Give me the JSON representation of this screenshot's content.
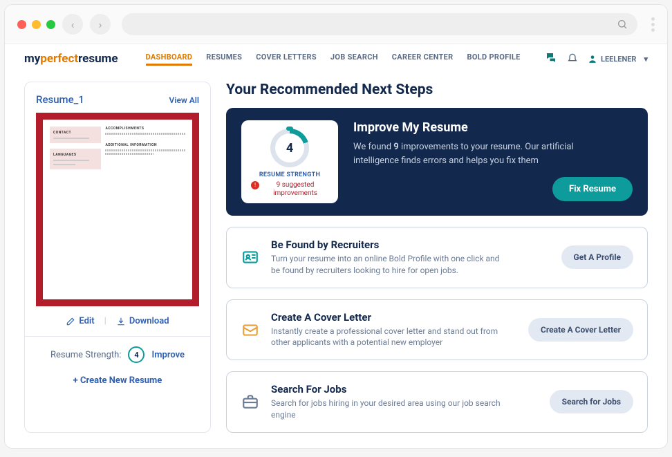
{
  "logo": {
    "part1": "my",
    "part2": "perfect",
    "part3": "resume"
  },
  "nav": {
    "dashboard": "DASHBOARD",
    "resumes": "RESUMES",
    "cover_letters": "COVER LETTERS",
    "job_search": "JOB SEARCH",
    "career_center": "CAREER CENTER",
    "bold_profile": "BOLD PROFILE"
  },
  "user_name": "LEELENER",
  "left": {
    "resume_name": "Resume_1",
    "view_all": "View All",
    "edit": "Edit",
    "download": "Download",
    "strength_label": "Resume Strength:",
    "strength_value": "4",
    "improve": "Improve",
    "create_new": "+  Create New Resume",
    "thumb": {
      "contact": "CONTACT",
      "languages": "LANGUAGES",
      "accomplishments": "ACCOMPLISHMENTS",
      "additional": "ADDITIONAL INFORMATION"
    }
  },
  "right": {
    "heading": "Your Recommended Next Steps",
    "feature": {
      "strength_label": "RESUME STRENGTH",
      "strength_value": "4",
      "suggested_count": "9",
      "suggested_text": "suggested improvements",
      "title": "Improve My Resume",
      "text_before": "We found ",
      "text_bold": "9",
      "text_after": " improvements to your resume. Our artificial intelligence finds errors and helps you fix them",
      "button": "Fix Resume"
    },
    "steps": {
      "recruiters": {
        "title": "Be Found by Recruiters",
        "text": "Turn your resume into an online Bold Profile with one click and be found by recruiters looking to hire for open jobs.",
        "button": "Get A Profile"
      },
      "cover_letter": {
        "title": "Create A Cover Letter",
        "text": "Instantly create a professional cover letter and stand out from other applicants with a potential new employer",
        "button": "Create A Cover Letter"
      },
      "jobs": {
        "title": "Search For Jobs",
        "text": "Search for jobs hiring in your desired area using our job search engine",
        "button": "Search for Jobs"
      }
    }
  }
}
